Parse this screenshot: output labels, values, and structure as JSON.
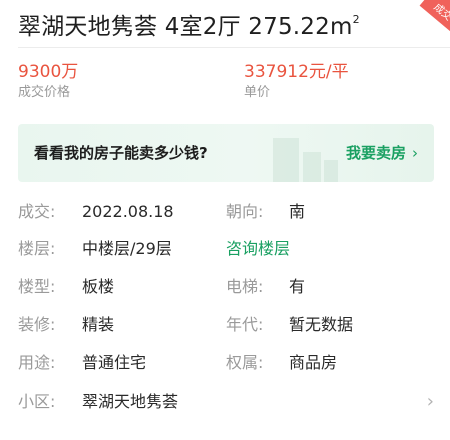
{
  "title": {
    "main": "翠湖天地隽荟 4室2厅 275.22m",
    "superscript": "2"
  },
  "corner_badge": "成交",
  "metrics": [
    {
      "value": "9300万",
      "label": "成交价格"
    },
    {
      "value": "337912元/平",
      "label": "单价"
    }
  ],
  "banner": {
    "question": "看看我的房子能卖多少钱?",
    "action": "我要卖房",
    "chevron": "›"
  },
  "details": {
    "deal_date": {
      "label": "成交:",
      "value": "2022.08.18"
    },
    "orientation": {
      "label": "朝向:",
      "value": "南"
    },
    "floor": {
      "label": "楼层:",
      "value": "中楼层/29层"
    },
    "floor_consult": "咨询楼层",
    "building_type": {
      "label": "楼型:",
      "value": "板楼"
    },
    "elevator": {
      "label": "电梯:",
      "value": "有"
    },
    "decoration": {
      "label": "装修:",
      "value": "精装"
    },
    "year": {
      "label": "年代:",
      "value": "暂无数据"
    },
    "usage": {
      "label": "用途:",
      "value": "普通住宅"
    },
    "ownership": {
      "label": "权属:",
      "value": "商品房"
    },
    "community": {
      "label": "小区:",
      "value": "翠湖天地隽荟"
    }
  },
  "colors": {
    "price": "#e9543f",
    "accent_green": "#1aa062",
    "label_gray": "#9a9a9a"
  },
  "icons": {
    "banner_arrow": "chevron-right-icon",
    "community_arrow": "chevron-right-icon"
  }
}
